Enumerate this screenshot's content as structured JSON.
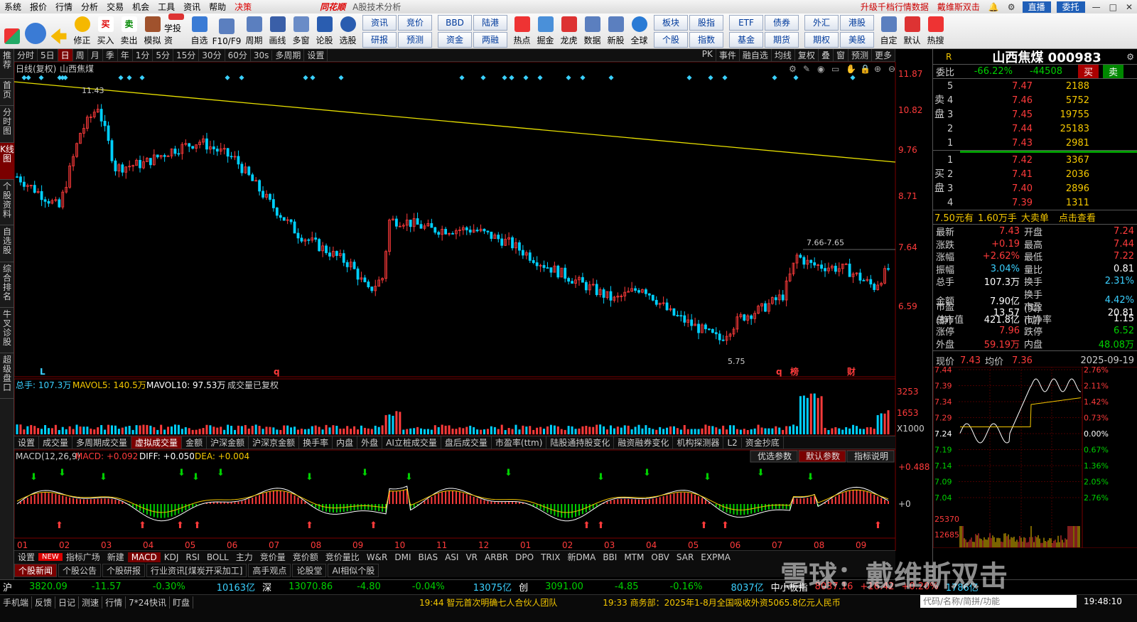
{
  "menu": {
    "items": [
      "系统",
      "报价",
      "行情",
      "分析",
      "交易",
      "机会",
      "工具",
      "资讯",
      "帮助"
    ],
    "highlight": "决策",
    "brand": "同花顺",
    "subtitle": "A股技术分析",
    "right_links": [
      "升级千档行情数据",
      "戴维斯双击"
    ],
    "live_btn": "直播",
    "account_btn": "委托"
  },
  "toolbar": {
    "buttons": [
      "修正",
      "买入",
      "卖出",
      "模拟",
      "学投资",
      "自选",
      "F10/F9",
      "周期",
      "画线",
      "多窗",
      "论股",
      "选股"
    ],
    "grid1": [
      "资讯",
      "竞价",
      "研报",
      "预测"
    ],
    "grid2": [
      "BBD",
      "陆港",
      "资金",
      "两融"
    ],
    "buttons2": [
      "热点",
      "掘金",
      "龙虎",
      "数据",
      "新股",
      "全球"
    ],
    "grid3": [
      "板块",
      "股指",
      "个股",
      "指数"
    ],
    "grid4": [
      "ETF",
      "债券",
      "基金",
      "期货"
    ],
    "grid5": [
      "外汇",
      "港股",
      "期权",
      "美股"
    ],
    "buttons3": [
      "自定",
      "默认",
      "热搜"
    ]
  },
  "left_tabs": [
    "推荐",
    "首页",
    "分时图",
    "K线图",
    "个股资料",
    "自选股",
    "综合排名",
    "牛叉诊股",
    "超级盘口"
  ],
  "period_bar": {
    "items": [
      "分时",
      "5日",
      "日",
      "周",
      "月",
      "季",
      "年",
      "1分",
      "5分",
      "15分",
      "30分",
      "60分",
      "30s",
      "多周期",
      "设置"
    ],
    "selected": "日",
    "right": [
      "PK",
      "事件",
      "融自选",
      "均线",
      "复权",
      "叠",
      "窗",
      "预测",
      "更多"
    ]
  },
  "kline": {
    "title": "日线(复权)",
    "stock": "山西焦煤",
    "price_ticks": [
      "11.87",
      "10.82",
      "9.76",
      "8.71",
      "7.64",
      "6.59"
    ],
    "high_label": "11.43",
    "low_label": "5.75",
    "range_label": "7.66-7.65",
    "markers": [
      "L",
      "q",
      "q",
      "榜",
      "财"
    ]
  },
  "volume": {
    "label": "总手: 107.3万",
    "mavol5": "MAVOL5: 140.5万",
    "mavol10": "MAVOL10: 97.53万",
    "note": "成交量已复权",
    "ticks": [
      "3253",
      "1653",
      "X1000"
    ]
  },
  "ind_tabs": [
    "设置",
    "成交量",
    "多周期成交量",
    "虚拟成交量",
    "金额",
    "沪深金额",
    "沪深京金额",
    "换手率",
    "内盘",
    "外盘",
    "AI立桩成交量",
    "盘后成交量",
    "市盈率(ttm)",
    "陆股通持股变化",
    "融资融券变化",
    "机构探测器",
    "L2",
    "资金抄底"
  ],
  "ind_tabs_selected": "虚拟成交量",
  "macd": {
    "label": "MACD(12,26,9)",
    "macd_val": "MACD: +0.092",
    "diff": "DIFF: +0.050",
    "dea": "DEA: +0.004",
    "buttons": [
      "优选参数",
      "默认参数",
      "指标说明"
    ],
    "ticks": [
      "+0.488",
      "+0"
    ]
  },
  "x_axis": [
    "01",
    "02",
    "03",
    "04",
    "05",
    "06",
    "07",
    "08",
    "09",
    "10",
    "11",
    "12",
    "01",
    "02",
    "03",
    "04",
    "05",
    "06",
    "07",
    "08",
    "09"
  ],
  "ind_tabs2": [
    "设置",
    "NEW",
    "指标广场",
    "新建",
    "MACD",
    "KDJ",
    "RSI",
    "BOLL",
    "主力",
    "竞价量",
    "竞价额",
    "竞价量比",
    "W&R",
    "DMI",
    "BIAS",
    "ASI",
    "VR",
    "ARBR",
    "DPO",
    "TRIX",
    "新DMA",
    "BBI",
    "MTM",
    "OBV",
    "SAR",
    "EXPMA"
  ],
  "news_tabs": [
    "个股新闻",
    "个股公告",
    "个股研报",
    "行业资讯[煤炭开采加工]",
    "高手观点",
    "论股堂",
    "AI相似个股"
  ],
  "quote": {
    "r": "R",
    "name": "山西焦煤 000983",
    "weibi_label": "委比",
    "weibi": "-66.22%",
    "weicha": "-44508",
    "buy": "买",
    "sell": "卖",
    "asks": [
      [
        "5",
        "7.47",
        "2188"
      ],
      [
        "4",
        "7.46",
        "5752"
      ],
      [
        "3",
        "7.45",
        "19755"
      ],
      [
        "2",
        "7.44",
        "25183"
      ],
      [
        "1",
        "7.43",
        "2981"
      ]
    ],
    "bids": [
      [
        "1",
        "7.42",
        "3367"
      ],
      [
        "2",
        "7.41",
        "2036"
      ],
      [
        "3",
        "7.40",
        "2896"
      ],
      [
        "4",
        "7.39",
        "1311"
      ]
    ],
    "ask_label": "卖盘",
    "bid_label": "买盘",
    "bigorder": [
      "7.50元有",
      "1.60万手",
      "大卖单",
      "点击查看"
    ],
    "stats": [
      [
        "最新",
        "7.43",
        "开盘",
        "7.24"
      ],
      [
        "涨跌",
        "+0.19",
        "最高",
        "7.44"
      ],
      [
        "涨幅",
        "+2.62%",
        "最低",
        "7.22"
      ],
      [
        "振幅",
        "3.04%",
        "量比",
        "0.81"
      ],
      [
        "总手",
        "107.3万",
        "换手",
        "2.31%"
      ],
      [
        "金额",
        "7.90亿",
        "换手(实)",
        "4.42%"
      ],
      [
        "市盈(静)",
        "13.57",
        "市盈(动)",
        "20.81"
      ],
      [
        "总市值",
        "421.8亿",
        "市净率",
        "1.15"
      ],
      [
        "涨停",
        "7.96",
        "跌停",
        "6.52"
      ],
      [
        "外盘",
        "59.19万",
        "内盘",
        "48.08万"
      ]
    ],
    "intraday": {
      "now_label": "现价",
      "now": "7.43",
      "avg_label": "均价",
      "avg": "7.36",
      "date": "2025-09-19",
      "left_ticks": [
        "7.44",
        "7.39",
        "7.34",
        "7.29",
        "7.24",
        "7.19",
        "7.14",
        "7.09",
        "7.04"
      ],
      "right_ticks": [
        "2.76%",
        "2.11%",
        "1.42%",
        "0.73%",
        "0.00%",
        "0.67%",
        "1.36%",
        "2.05%",
        "2.76%"
      ],
      "vol_ticks": [
        "25370",
        "12685"
      ]
    }
  },
  "status": {
    "sh": "沪",
    "sh_val": "3820.09",
    "sh_chg": "-11.57",
    "sh_pct": "-0.30%",
    "sh_amt": "10163亿",
    "sz": "深",
    "sz_val": "13070.86",
    "sz_chg": "-4.80",
    "sz_pct": "-0.04%",
    "sz_amt": "13075亿",
    "cy": "创",
    "cy_val": "3091.00",
    "cy_chg": "-4.85",
    "cy_pct": "-0.16%",
    "cy_amt": "8037亿",
    "zx": "中小板指",
    "zx_val": "8037.16",
    "zx_chg": "+16.42",
    "zx_pct": "+0.20%",
    "zx_amt": "1786亿"
  },
  "bottom": {
    "links": [
      "手机端",
      "反馈",
      "日记",
      "测速",
      "行情",
      "7*24快讯",
      "盯盘"
    ],
    "news1": "19:44 智元首次明确七人合伙人团队",
    "news2": "19:33 商务部：2025年1-8月全国吸收外资5065.8亿元人民币",
    "search_placeholder": "代码/名称/简拼/功能",
    "clock": "19:48:10"
  },
  "watermark": "雪球：戴维斯双击",
  "colors": {
    "up": "#ff3b3b",
    "down": "#00d000",
    "ma": "#f5c800",
    "bg": "#000000",
    "accent": "#7a0000"
  }
}
